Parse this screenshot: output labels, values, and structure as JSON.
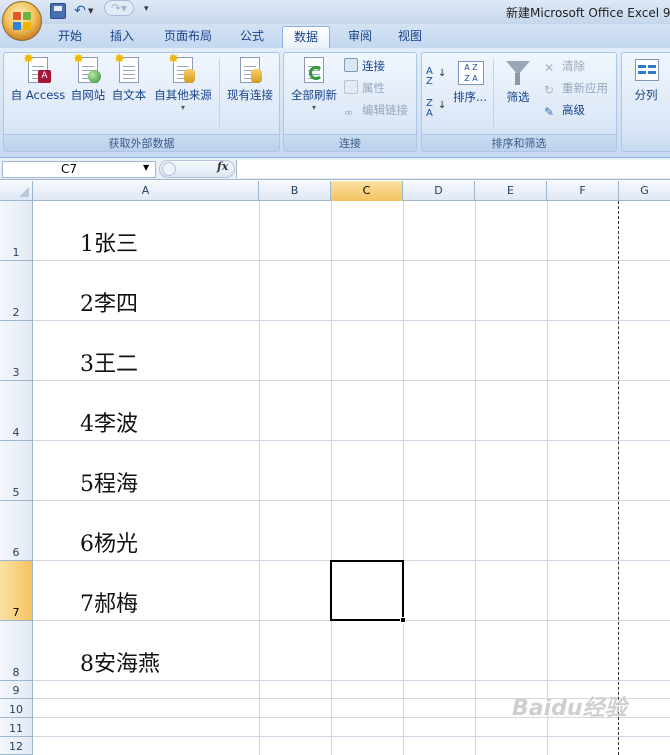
{
  "window": {
    "title": "新建Microsoft Office Excel 9"
  },
  "quick_access": {
    "save_icon": "save-icon",
    "undo_icon": "undo-icon",
    "redo_icon": "redo-icon"
  },
  "tabs": [
    {
      "label": "开始",
      "active": false
    },
    {
      "label": "插入",
      "active": false
    },
    {
      "label": "页面布局",
      "active": false
    },
    {
      "label": "公式",
      "active": false
    },
    {
      "label": "数据",
      "active": true
    },
    {
      "label": "审阅",
      "active": false
    },
    {
      "label": "视图",
      "active": false
    }
  ],
  "ribbon": {
    "external": {
      "label": "获取外部数据",
      "access": "自 Access",
      "web": "自网站",
      "text": "自文本",
      "other": "自其他来源",
      "existing": "现有连接"
    },
    "connections": {
      "label": "连接",
      "refresh": "全部刷新",
      "connect": "连接",
      "properties": "属性",
      "edit_links": "编辑链接"
    },
    "sort_filter": {
      "label": "排序和筛选",
      "sort": "排序...",
      "filter": "筛选",
      "clear": "清除",
      "reapply": "重新应用",
      "advanced": "高级"
    },
    "data_tools": {
      "split": "分列"
    }
  },
  "formula_bar": {
    "name_box": "C7",
    "fx": "fx",
    "formula": ""
  },
  "grid": {
    "columns": [
      "A",
      "B",
      "C",
      "D",
      "E",
      "F",
      "G"
    ],
    "selected_column": "C",
    "rows": [
      "1",
      "2",
      "3",
      "4",
      "5",
      "6",
      "7",
      "8",
      "9",
      "10",
      "11",
      "12"
    ],
    "selected_row": "7",
    "cells_A": [
      "1张三",
      "2李四",
      "3王二",
      "4李波",
      "5程海",
      "6杨光",
      "7郝梅",
      "8安海燕"
    ]
  },
  "watermark": "Baidu经验"
}
